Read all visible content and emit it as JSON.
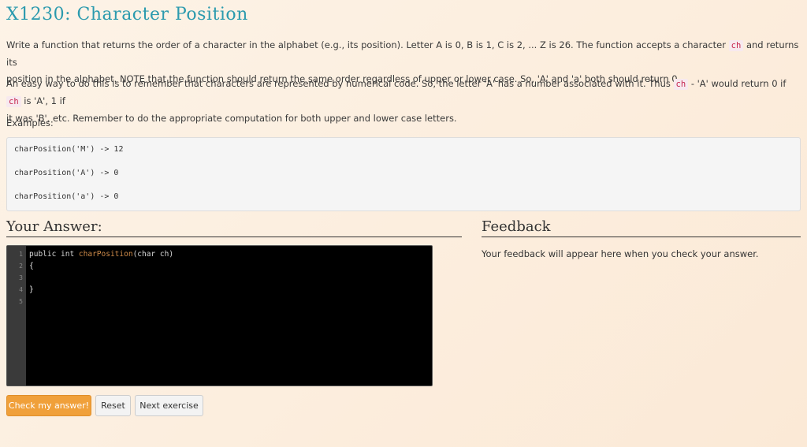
{
  "title": "X1230: Character Position",
  "description": {
    "p1_line1_a": "Write a function that returns the order of a character in the alphabet (e.g., its position). Letter A is 0, B is 1, C is 2, ... Z is 26. The function accepts a character ",
    "p1_code": "ch",
    "p1_line1_b": " and returns its",
    "p1_line2": "position in the alphabet. NOTE that the function should return the same order regardless of upper or lower case. So, 'A' and 'a' both should return 0.",
    "p2_line1_a": "An easy way to do this is to remember that characters are represented by numerical code. So, the letter 'A' has a number associated with it. Thus ",
    "p2_code1": "ch",
    "p2_line1_b": " - 'A' would return 0 if ",
    "p2_code2": "ch",
    "p2_line1_c": " is 'A', 1 if",
    "p2_line2": "it was 'B', etc. Remember to do the appropriate computation for both upper and lower case letters.",
    "examples_label": "Examples:"
  },
  "examples": [
    "charPosition('M') -> 12",
    "charPosition('A') -> 0",
    "charPosition('a') -> 0"
  ],
  "answer": {
    "heading": "Your Answer:",
    "line_numbers": [
      "1",
      "2",
      "3",
      "4",
      "5"
    ],
    "code_kw": "public int ",
    "code_fn": "charPosition",
    "code_args": "(char ch)",
    "code_line2": "{",
    "code_line4": "}"
  },
  "feedback": {
    "heading": "Feedback",
    "text": "Your feedback will appear here when you check your answer."
  },
  "buttons": {
    "check": "Check my answer!",
    "reset": "Reset",
    "next": "Next exercise"
  },
  "colors": {
    "title": "#2b9aae",
    "primary_button": "#f0a03a",
    "inline_code": "#c7254e"
  }
}
